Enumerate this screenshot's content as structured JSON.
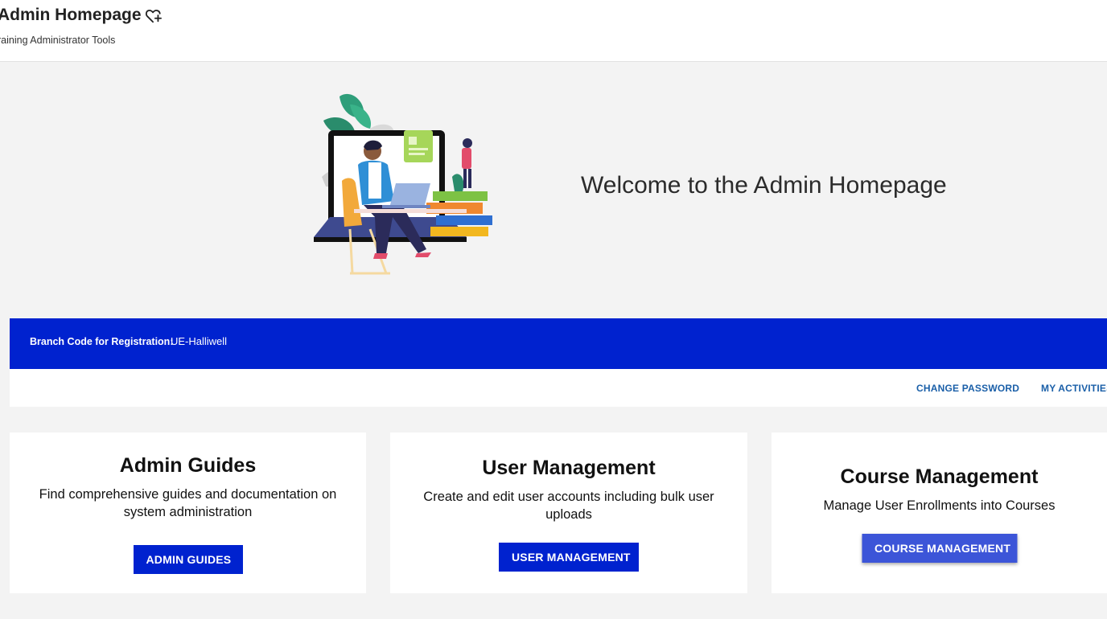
{
  "header": {
    "title": "Admin Homepage",
    "favorite_icon": "heart-plus-icon",
    "subtitle": "raining Administrator Tools"
  },
  "hero": {
    "illustration": "person-at-laptop-illustration",
    "welcome_text": "Welcome to the Admin Homepage"
  },
  "branch": {
    "label": "Branch Code for Registration:",
    "value": "UE-Halliwell"
  },
  "links": {
    "change_password": "CHANGE PASSWORD",
    "my_activities": "MY ACTIVITIES"
  },
  "cards": [
    {
      "title": "Admin Guides",
      "description": "Find comprehensive guides and documentation on system administration",
      "button": "ADMIN GUIDES"
    },
    {
      "title": "User Management",
      "description": "Create and edit user accounts including bulk user uploads",
      "button": "USER MANAGEMENT"
    },
    {
      "title": "Course Management",
      "description": "Manage User Enrollments into Courses",
      "button": "COURSE MANAGEMENT"
    }
  ],
  "colors": {
    "brand_blue": "#0022cf",
    "button_light_blue": "#3c55d8",
    "link_blue": "#1a5fa8",
    "page_background": "#f3f3f3"
  }
}
